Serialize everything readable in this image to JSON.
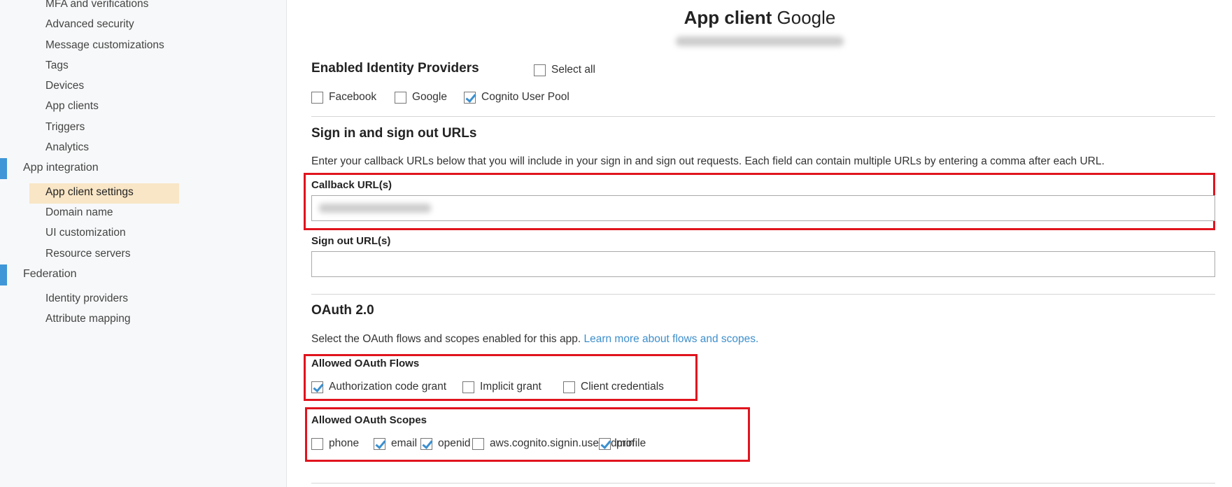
{
  "sidebar": {
    "items_top": [
      "MFA and verifications",
      "Advanced security",
      "Message customizations",
      "Tags",
      "Devices",
      "App clients",
      "Triggers",
      "Analytics"
    ],
    "group_app_integration": "App integration",
    "app_integration_items": [
      "App client settings",
      "Domain name",
      "UI customization",
      "Resource servers"
    ],
    "group_federation": "Federation",
    "federation_items": [
      "Identity providers",
      "Attribute mapping"
    ]
  },
  "header": {
    "title_bold": "App client",
    "title_name": "Google"
  },
  "providers": {
    "heading": "Enabled Identity Providers",
    "select_all": "Select all",
    "items": [
      {
        "label": "Facebook",
        "checked": false
      },
      {
        "label": "Google",
        "checked": false
      },
      {
        "label": "Cognito User Pool",
        "checked": true
      }
    ]
  },
  "urls": {
    "heading": "Sign in and sign out URLs",
    "description": "Enter your callback URLs below that you will include in your sign in and sign out requests. Each field can contain multiple URLs by entering a comma after each URL.",
    "callback_label": "Callback URL(s)",
    "signout_label": "Sign out URL(s)",
    "signout_value": ""
  },
  "oauth": {
    "heading": "OAuth 2.0",
    "description": "Select the OAuth flows and scopes enabled for this app.",
    "link": "Learn more about flows and scopes.",
    "flows_label": "Allowed OAuth Flows",
    "flows": [
      {
        "label": "Authorization code grant",
        "checked": true
      },
      {
        "label": "Implicit grant",
        "checked": false
      },
      {
        "label": "Client credentials",
        "checked": false
      }
    ],
    "scopes_label": "Allowed OAuth Scopes",
    "scopes": [
      {
        "label": "phone",
        "checked": false
      },
      {
        "label": "email",
        "checked": true
      },
      {
        "label": "openid",
        "checked": true
      },
      {
        "label": "aws.cognito.signin.user.admin",
        "checked": false
      },
      {
        "label": "profile",
        "checked": true
      }
    ]
  },
  "colors": {
    "accent": "#3f97d8",
    "highlight": "#f9e6c6",
    "annotation": "#e0141e",
    "link": "#3d8fcc"
  }
}
